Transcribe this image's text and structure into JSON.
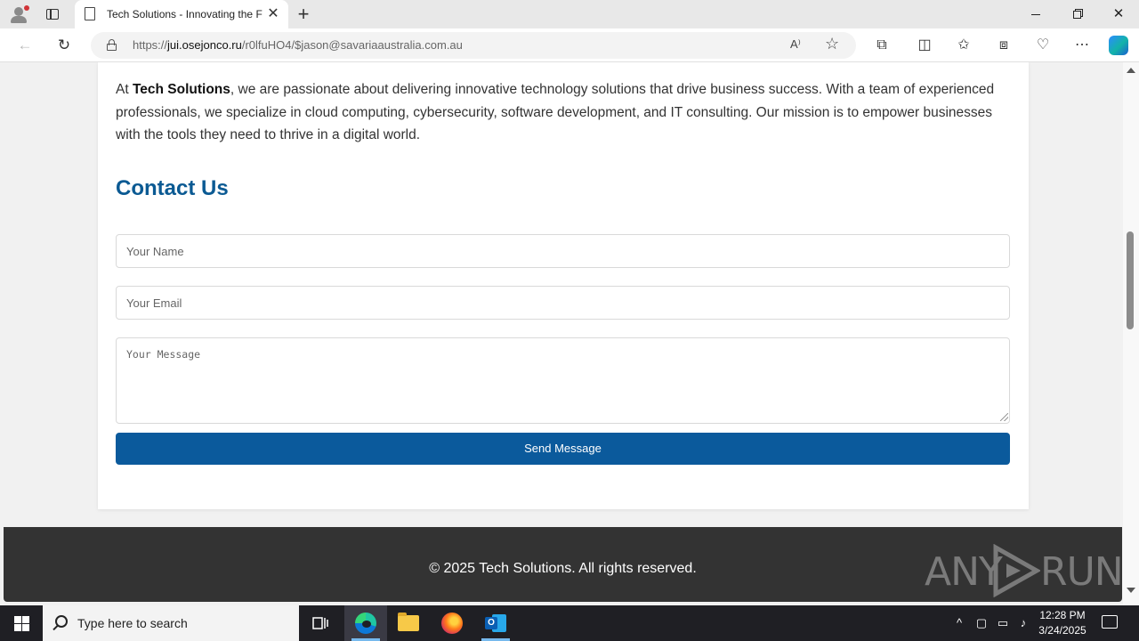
{
  "browser": {
    "tab_title": "Tech Solutions - Innovating the F",
    "tab_close": "✕",
    "new_tab": "+",
    "url_prefix": "https://",
    "url_host": "jui.osejonco.ru",
    "url_path": "/r0lfuHO4/$jason@savariaaustralia.com.au",
    "read_aloud": "A⁾",
    "favorite": "☆",
    "back": "←",
    "reload": "↻",
    "window_close": "✕"
  },
  "page": {
    "about_prefix": "At ",
    "about_brand": "Tech Solutions",
    "about_rest": ", we are passionate about delivering innovative technology solutions that drive business success. With a team of experienced professionals, we specialize in cloud computing, cybersecurity, software development, and IT consulting. Our mission is to empower businesses with the tools they need to thrive in a digital world.",
    "contact_title": "Contact Us",
    "name_placeholder": "Your Name",
    "email_placeholder": "Your Email",
    "message_placeholder": "Your Message",
    "send_label": "Send Message",
    "footer_text": "© 2025 Tech Solutions. All rights reserved."
  },
  "watermark": {
    "left": "ANY",
    "right": "RUN"
  },
  "taskbar": {
    "search_placeholder": "Type here to search",
    "time": "12:28 PM",
    "date": "3/24/2025",
    "tray_chevron": "^"
  },
  "colors": {
    "accent": "#0b5a9c",
    "heading": "#0b5a93",
    "footer_bg": "#333333"
  }
}
